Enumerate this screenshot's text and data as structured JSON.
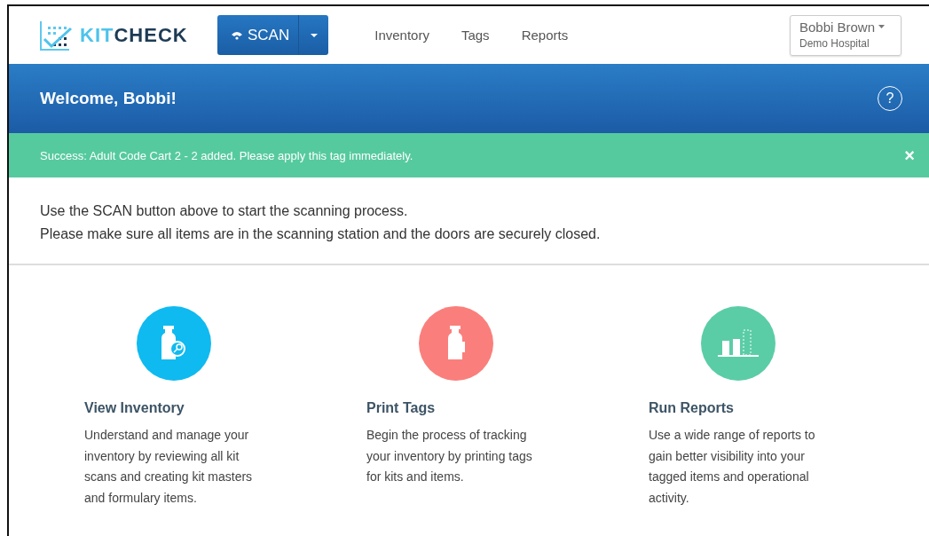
{
  "header": {
    "logo": {
      "part_1": "KIT",
      "part_2": "CHECK"
    },
    "scan_button": "SCAN",
    "nav": [
      {
        "label": "Inventory"
      },
      {
        "label": "Tags"
      },
      {
        "label": "Reports"
      }
    ],
    "user": {
      "name": "Bobbi Brown",
      "organization": "Demo Hospital"
    }
  },
  "welcome": {
    "title": "Welcome, Bobbi!",
    "help": "?"
  },
  "alert": {
    "message": "Success: Adult Code Cart 2 - 2 added. Please apply this tag immediately.",
    "close": "×"
  },
  "instructions": [
    "Use the SCAN button above to start the scanning process.",
    "Please make sure all items are in the scanning station and the doors are securely closed."
  ],
  "cards": [
    {
      "kind": "inventory",
      "color": "#0fbaf0",
      "title": "View Inventory",
      "text": "Understand and manage your inventory by reviewing all kit scans and creating kit masters and formulary items."
    },
    {
      "kind": "tags",
      "color": "#fa7f7c",
      "title": "Print Tags",
      "text": "Begin the process of tracking your inventory by printing tags for kits and items."
    },
    {
      "kind": "reports",
      "color": "#5bcda6",
      "title": "Run Reports",
      "text": "Use a wide range of reports to gain better visibility into your tagged items and operational activity."
    }
  ]
}
